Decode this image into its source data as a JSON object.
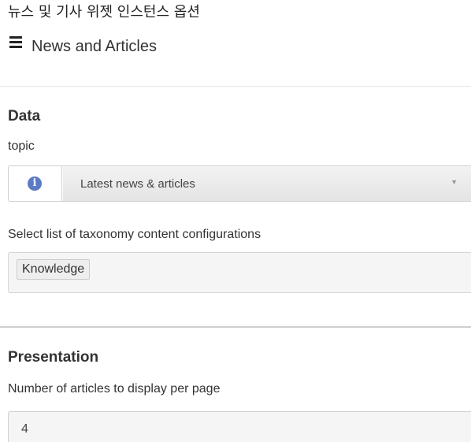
{
  "caption": "뉴스 및 기사 위젯 인스턴스 옵션",
  "header": {
    "menu_icon": "hamburger-menu-icon",
    "title": "News and Articles"
  },
  "data_section": {
    "title": "Data",
    "topic_label": "topic",
    "topic_icon": "info-icon",
    "topic_value": "Latest news & articles",
    "taxonomy_label": "Select list of taxonomy content configurations",
    "taxonomy_tags": [
      "Knowledge"
    ]
  },
  "presentation_section": {
    "title": "Presentation",
    "articles_per_page_label": "Number of articles to display per page",
    "articles_per_page_value": "4"
  },
  "colors": {
    "info_icon": "#5b7bc4",
    "text": "#333333",
    "border": "#cfcfcf"
  }
}
